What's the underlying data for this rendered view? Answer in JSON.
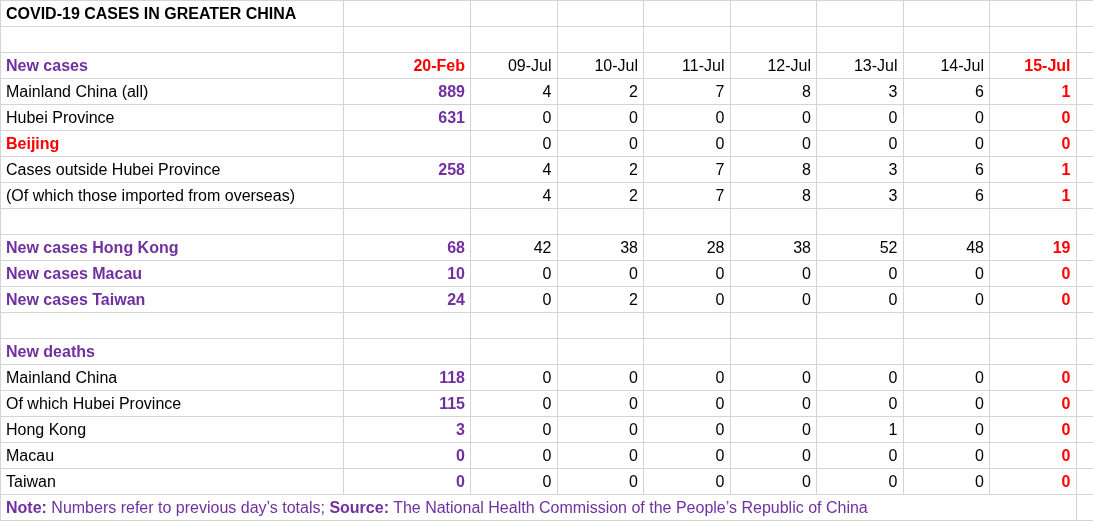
{
  "columns": [
    {
      "header": "20-Feb",
      "kind": "baseline"
    },
    {
      "header": "09-Jul",
      "kind": "day"
    },
    {
      "header": "10-Jul",
      "kind": "day"
    },
    {
      "header": "11-Jul",
      "kind": "day"
    },
    {
      "header": "12-Jul",
      "kind": "day"
    },
    {
      "header": "13-Jul",
      "kind": "day"
    },
    {
      "header": "14-Jul",
      "kind": "day"
    },
    {
      "header": "15-Jul",
      "kind": "latest"
    }
  ],
  "rows": [
    {
      "kind": "title",
      "label": "COVID-19 CASES IN GREATER CHINA"
    },
    {
      "kind": "blank"
    },
    {
      "kind": "header",
      "label": "New cases"
    },
    {
      "kind": "row",
      "label": "Mainland China (all)",
      "cells": [
        "889",
        "4",
        "2",
        "7",
        "8",
        "3",
        "6",
        "1"
      ]
    },
    {
      "kind": "row",
      "label": "Hubei Province",
      "cells": [
        "631",
        "0",
        "0",
        "0",
        "0",
        "0",
        "0",
        "0"
      ]
    },
    {
      "kind": "alert",
      "label": "Beijing",
      "cells": [
        null,
        "0",
        "0",
        "0",
        "0",
        "0",
        "0",
        "0"
      ]
    },
    {
      "kind": "row",
      "label": "Cases outside Hubei Province",
      "cells": [
        "258",
        "4",
        "2",
        "7",
        "8",
        "3",
        "6",
        "1"
      ]
    },
    {
      "kind": "row",
      "label": "(Of which those imported from overseas)",
      "cells": [
        null,
        "4",
        "2",
        "7",
        "8",
        "3",
        "6",
        "1"
      ]
    },
    {
      "kind": "blank"
    },
    {
      "kind": "section",
      "label": "New cases Hong Kong",
      "cells": [
        "68",
        "42",
        "38",
        "28",
        "38",
        "52",
        "48",
        "19"
      ]
    },
    {
      "kind": "section",
      "label": "New cases Macau",
      "cells": [
        "10",
        "0",
        "0",
        "0",
        "0",
        "0",
        "0",
        "0"
      ]
    },
    {
      "kind": "section",
      "label": "New cases Taiwan",
      "cells": [
        "24",
        "0",
        "2",
        "0",
        "0",
        "0",
        "0",
        "0"
      ]
    },
    {
      "kind": "blank"
    },
    {
      "kind": "section",
      "label": "New deaths"
    },
    {
      "kind": "row",
      "label": "Mainland China",
      "cells": [
        "118",
        "0",
        "0",
        "0",
        "0",
        "0",
        "0",
        "0"
      ]
    },
    {
      "kind": "row",
      "label": "Of which Hubei Province",
      "cells": [
        "115",
        "0",
        "0",
        "0",
        "0",
        "0",
        "0",
        "0"
      ]
    },
    {
      "kind": "row",
      "label": "Hong Kong",
      "cells": [
        "3",
        "0",
        "0",
        "0",
        "0",
        "1",
        "0",
        "0"
      ]
    },
    {
      "kind": "row",
      "label": "Macau",
      "cells": [
        "0",
        "0",
        "0",
        "0",
        "0",
        "0",
        "0",
        "0"
      ]
    },
    {
      "kind": "row",
      "label": "Taiwan",
      "cells": [
        "0",
        "0",
        "0",
        "0",
        "0",
        "0",
        "0",
        "0"
      ]
    },
    {
      "kind": "note",
      "text": "**Note:** Numbers refer to previous day’s totals; **Source:** The National Health Commission of the People’s Republic of China"
    }
  ]
}
